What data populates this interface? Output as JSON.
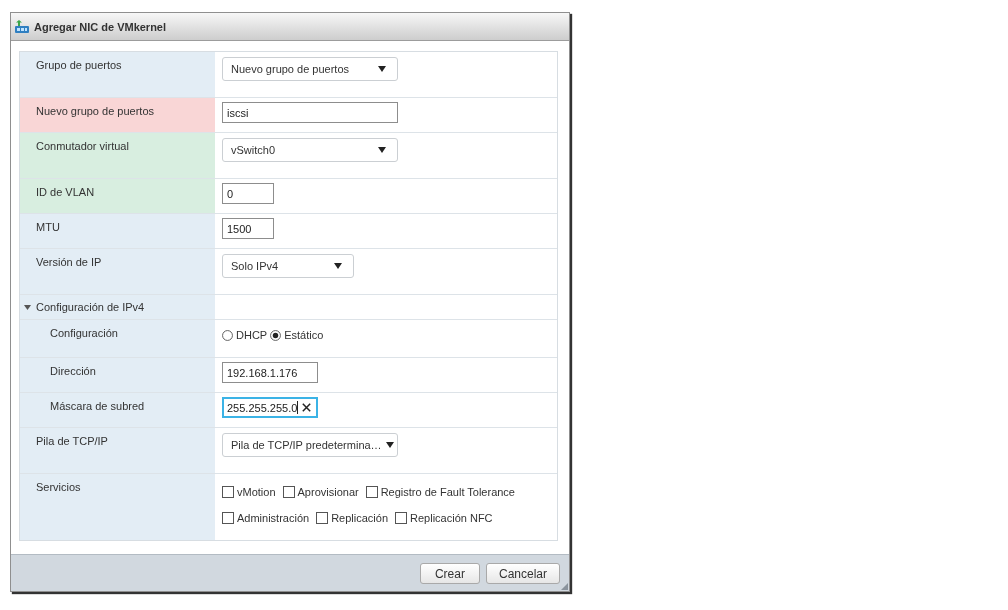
{
  "window": {
    "title": "Agregar NIC de VMkernel"
  },
  "form": {
    "rows": [
      {
        "kind": "select",
        "label": "Grupo de puertos",
        "color": "#e3edf5",
        "value": "Nuevo grupo de puertos"
      },
      {
        "kind": "text",
        "label": "Nuevo grupo de puertos",
        "color": "#f9d6d6",
        "value": "iscsi",
        "focused": false
      },
      {
        "kind": "select",
        "label": "Conmutador virtual",
        "color": "#d8eee0",
        "value": "vSwitch0"
      },
      {
        "kind": "text",
        "label": "ID de VLAN",
        "color": "#d8eee0",
        "value": "0",
        "focused": false
      },
      {
        "kind": "text",
        "label": "MTU",
        "color": "#e3edf5",
        "value": "1500",
        "focused": false
      },
      {
        "kind": "select",
        "label": "Versión de IP",
        "color": "#e3edf5",
        "value": "Solo IPv4"
      },
      {
        "kind": "section",
        "label": "Configuración de IPv4",
        "color": "#e3edf5",
        "expanded": true,
        "children": [
          {
            "kind": "radio",
            "label": "Configuración",
            "color": "#e3edf5",
            "options": [
              {
                "label": "DHCP",
                "selected": false
              },
              {
                "label": "Estático",
                "selected": true
              }
            ]
          },
          {
            "kind": "text",
            "label": "Dirección",
            "color": "#e3edf5",
            "value": "192.168.1.176",
            "focused": false
          },
          {
            "kind": "text",
            "label": "Máscara de subred",
            "color": "#e3edf5",
            "value": "255.255.255.0",
            "focused": true
          }
        ]
      },
      {
        "kind": "select",
        "label": "Pila de TCP/IP",
        "color": "#e3edf5",
        "value": "Pila de TCP/IP predetermina…"
      },
      {
        "kind": "checkboxes",
        "label": "Servicios",
        "color": "#e3edf5",
        "options": [
          {
            "label": "vMotion",
            "checked": false
          },
          {
            "label": "Aprovisionar",
            "checked": false
          },
          {
            "label": "Registro de Fault Tolerance",
            "checked": false
          },
          {
            "label": "Administración",
            "checked": false
          },
          {
            "label": "Replicación",
            "checked": false
          },
          {
            "label": "Replicación NFC",
            "checked": false
          }
        ]
      }
    ]
  },
  "buttons": [
    {
      "label": "Crear"
    },
    {
      "label": "Cancelar"
    }
  ]
}
